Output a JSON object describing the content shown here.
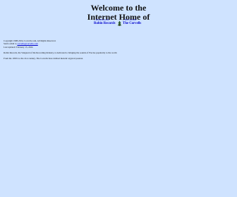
{
  "header": {
    "title_line1": "Welcome to the",
    "title_line2": "Internet Home of"
  },
  "links": {
    "left_small": "Robin Records",
    "left_big": "Robin Records",
    "right_small": "The Corvells",
    "right_big": "The Corvells"
  },
  "footer": {
    "copyright": "Copyright 1998-2024, Corvells.com, All Rights Reserved.",
    "mail_label": "Send e-mail to",
    "mail_link": "corvells@corvells.com",
    "updated": "Last updated: February 15, 2024",
    "paragraph1": "Robin Records, the Vanguard of the Recording Industry, is dedicated to bringing the sounds of Precise popularity to the world.",
    "paragraph2": "From the 1950's to the 21st century, The Corvells have dubbed melodic atypical passion."
  },
  "colors": {
    "background": "#cfe3ff",
    "link": "#0000cc"
  }
}
